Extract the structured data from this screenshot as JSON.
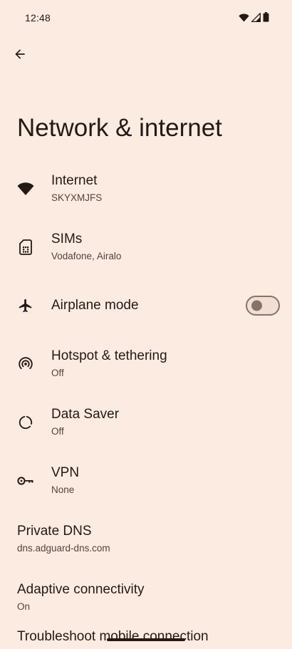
{
  "status_bar": {
    "time": "12:48",
    "icons": [
      "wifi-icon",
      "signal-icon",
      "battery-icon"
    ]
  },
  "header": {
    "back_icon": "arrow-back-icon",
    "title": "Network & internet"
  },
  "settings": {
    "items": [
      {
        "title": "Internet",
        "subtitle": "SKYXMJFS",
        "icon": "wifi-icon"
      },
      {
        "title": "SIMs",
        "subtitle": "Vodafone, Airalo",
        "icon": "sim-card-icon"
      },
      {
        "title": "Airplane mode",
        "subtitle": "",
        "icon": "airplane-icon",
        "toggle_on": false
      },
      {
        "title": "Hotspot & tethering",
        "subtitle": "Off",
        "icon": "hotspot-icon"
      },
      {
        "title": "Data Saver",
        "subtitle": "Off",
        "icon": "data-saver-icon"
      },
      {
        "title": "VPN",
        "subtitle": "None",
        "icon": "vpn-key-icon"
      },
      {
        "title": "Private DNS",
        "subtitle": "dns.adguard-dns.com"
      },
      {
        "title": "Adaptive connectivity",
        "subtitle": "On"
      },
      {
        "title": "Troubleshoot mobile connection",
        "subtitle": ""
      }
    ]
  },
  "colors": {
    "background": "#fcebe0",
    "text_primary": "#231a16",
    "text_secondary": "#52443c",
    "toggle_outline": "#85736a"
  }
}
